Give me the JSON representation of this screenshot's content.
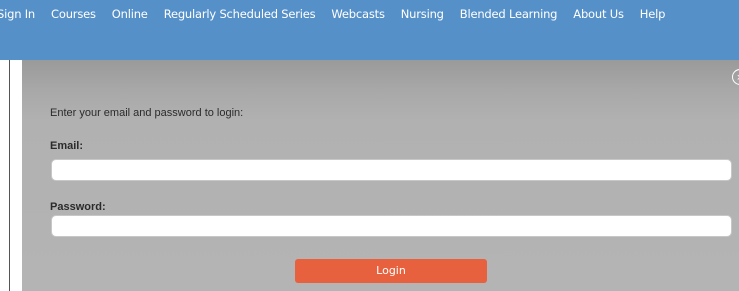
{
  "nav": {
    "items": [
      {
        "label": "Sign In"
      },
      {
        "label": "Courses"
      },
      {
        "label": "Online"
      },
      {
        "label": "Regularly Scheduled Series"
      },
      {
        "label": "Webcasts"
      },
      {
        "label": "Nursing"
      },
      {
        "label": "Blended Learning"
      },
      {
        "label": "About Us"
      },
      {
        "label": "Help"
      }
    ]
  },
  "modal": {
    "close_icon": "close-circle-icon",
    "close_glyph": "×",
    "intro": "Enter your email and password to login:",
    "email_label": "Email:",
    "email_value": "",
    "password_label": "Password:",
    "password_value": "",
    "login_label": "Login"
  },
  "colors": {
    "nav_bg": "#5590c9",
    "modal_bg": "#b1b1b1",
    "login_button": "#e8613e"
  }
}
